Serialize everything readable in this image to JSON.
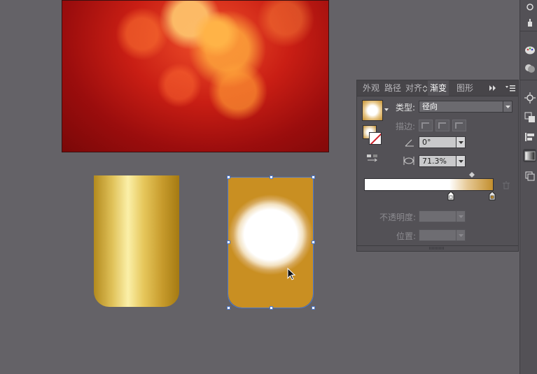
{
  "panel": {
    "tabs": {
      "appearance": "外观",
      "path": "路径",
      "align": "对齐",
      "gradient": "渐变",
      "graphic": "图形"
    },
    "type_label": "类型:",
    "type_value": "径向",
    "stroke_label": "描边:",
    "angle_value": "0°",
    "aspect_value": "71.3%",
    "opacity_label": "不透明度:",
    "location_label": "位置:",
    "gradient_stops": [
      {
        "color": "#ffffff",
        "position": 0.66
      },
      {
        "color": "#c38f2e",
        "position": 1.0
      }
    ]
  },
  "canvas": {
    "gold_gradient_colors": [
      "#b38a1e",
      "#fbf0a8",
      "#a57a12"
    ],
    "radial_gradient_colors": [
      "#ffffff",
      "#c98f22"
    ],
    "background_color": "#646267"
  },
  "icons": {
    "panel_menu": "panel-menu-icon",
    "expand": "expand-icon",
    "delete_stop": "trash-icon",
    "cursor": "arrow-cursor-icon"
  }
}
